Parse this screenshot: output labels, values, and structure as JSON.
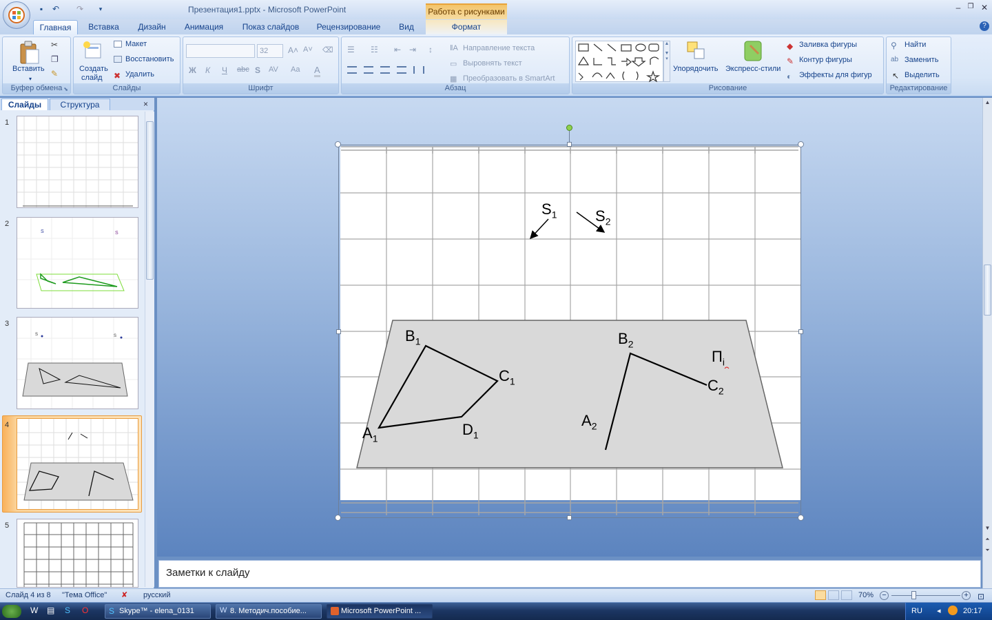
{
  "window": {
    "title": "Презентация1.pptx - Microsoft PowerPoint",
    "context_group": "Работа с рисунками"
  },
  "tabs": [
    "Главная",
    "Вставка",
    "Дизайн",
    "Анимация",
    "Показ слайдов",
    "Рецензирование",
    "Вид",
    "Формат"
  ],
  "ribbon": {
    "clipboard": {
      "label": "Буфер обмена",
      "paste": "Вставить"
    },
    "slides": {
      "label": "Слайды",
      "new_slide_1": "Создать",
      "new_slide_2": "слайд",
      "layout": "Макет",
      "reset": "Восстановить",
      "delete": "Удалить"
    },
    "font": {
      "label": "Шрифт",
      "size": "32"
    },
    "paragraph": {
      "label": "Абзац",
      "text_direction": "Направление текста",
      "align_text": "Выровнять текст",
      "smartart": "Преобразовать в SmartArt"
    },
    "drawing": {
      "label": "Рисование",
      "arrange": "Упорядочить",
      "quick_styles": "Экспресс-стили",
      "fill": "Заливка фигуры",
      "outline": "Контур фигуры",
      "effects": "Эффекты для фигур"
    },
    "editing": {
      "label": "Редактирование",
      "find": "Найти",
      "replace": "Заменить",
      "select": "Выделить"
    }
  },
  "left_pane": {
    "tab_slides": "Слайды",
    "tab_outline": "Структура",
    "slide_numbers": [
      "1",
      "2",
      "3",
      "4",
      "5"
    ]
  },
  "slide": {
    "labels": {
      "S": "S",
      "A": "A",
      "B": "B",
      "C": "C",
      "D": "D",
      "Pi": "П",
      "sub1": "1",
      "sub2": "2",
      "subi": "i"
    }
  },
  "notes": {
    "placeholder": "Заметки к слайду"
  },
  "status": {
    "slide": "Слайд 4 из 8",
    "theme": "\"Тема Office\"",
    "language": "русский",
    "zoom": "70%"
  },
  "taskbar": {
    "tasks": [
      "Skype™ - elena_0131",
      "8. Методич.пособие...",
      "Microsoft PowerPoint ..."
    ],
    "lang": "RU",
    "time": "20:17"
  }
}
